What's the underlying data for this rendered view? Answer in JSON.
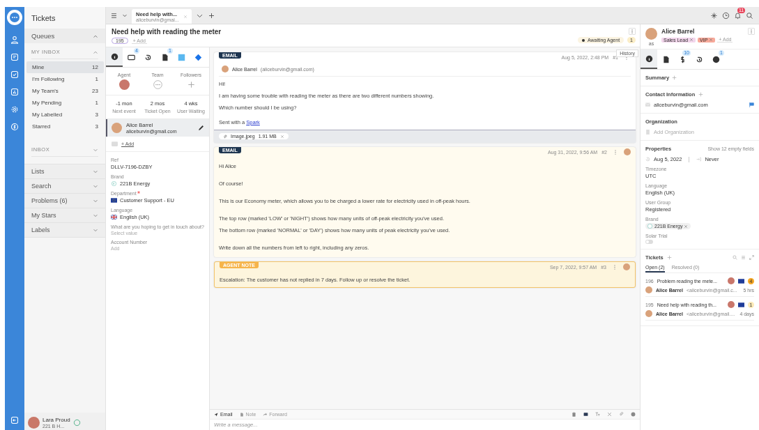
{
  "sidebar": {
    "title": "Tickets",
    "queues": {
      "label": "Queues",
      "expanded": true
    },
    "my_inbox": {
      "label": "MY INBOX",
      "expanded": true,
      "items": [
        {
          "label": "Mine",
          "count": "12",
          "selected": true
        },
        {
          "label": "I'm Following",
          "count": "1",
          "selected": false
        },
        {
          "label": "My Team's",
          "count": "23",
          "selected": false
        },
        {
          "label": "My Pending",
          "count": "1",
          "selected": false
        },
        {
          "label": "My Labelled",
          "count": "3",
          "selected": false
        },
        {
          "label": "Starred",
          "count": "3",
          "selected": false
        }
      ]
    },
    "inbox": {
      "label": "INBOX",
      "expanded": false
    },
    "sections": [
      {
        "label": "Lists",
        "expanded": false
      },
      {
        "label": "Search",
        "expanded": false
      },
      {
        "label": "Problems (6)",
        "expanded": false
      },
      {
        "label": "My Stars",
        "expanded": false
      },
      {
        "label": "Labels",
        "expanded": false
      }
    ],
    "user": {
      "name": "Lara Proud",
      "brand": "221 B H..."
    }
  },
  "tabbar": {
    "tabs": [
      {
        "title": "Need help with...",
        "subtitle": "aliceburvin@gmai...",
        "selected": true
      }
    ],
    "notifications": "11"
  },
  "ticket": {
    "title": "Need help with reading the meter",
    "id": "195",
    "add_label": "+ Add",
    "status": "Awaiting Agent",
    "status_count": "1",
    "tooltip": "History"
  },
  "details": {
    "tabs": [
      {
        "selected": true
      },
      {
        "badge": "4",
        "selected": false
      },
      {
        "selected": false
      },
      {
        "badge": "1",
        "selected": false
      },
      {
        "selected": false
      },
      {
        "selected": false
      }
    ],
    "people": [
      {
        "label": "Agent",
        "kind": "avatar"
      },
      {
        "label": "Team",
        "kind": "chat"
      },
      {
        "label": "Followers",
        "kind": "add"
      }
    ],
    "stats": [
      {
        "value": "-1 mon",
        "label": "Next event"
      },
      {
        "value": "2 mos",
        "label": "Ticket Open"
      },
      {
        "value": "4 wks",
        "label": "User Waiting"
      }
    ],
    "requester": {
      "name": "Alice Barrel",
      "email": "aliceburvin@gmail.com"
    },
    "cc_add": "+ Add",
    "fields": [
      {
        "label": "Ref",
        "value": "DLLV-7196-DZBY",
        "kind": "text",
        "required": false
      },
      {
        "label": "Brand",
        "value": "221B Energy",
        "kind": "brand",
        "required": false
      },
      {
        "label": "Department",
        "value": "Customer Support - EU",
        "kind": "eu",
        "required": true
      },
      {
        "label": "Language",
        "value": "English (UK)",
        "kind": "uk",
        "required": false
      },
      {
        "label": "What are you hoping to get in touch about?",
        "placeholder": "Select value",
        "kind": "empty",
        "required": false
      },
      {
        "label": "Account Number",
        "placeholder": "Add",
        "kind": "empty",
        "required": false
      }
    ]
  },
  "messages": [
    {
      "kind": "incoming",
      "badge": "EMAIL",
      "date": "Aug 5, 2022, 2:48 PM",
      "number": "#1",
      "sender": "Alice Barrel",
      "sender_email": "(aliceburvin@gmail.com)",
      "blocks": [
        {
          "lines": [
            {
              "text": "Hi!"
            },
            {
              "text": "I am having some trouble with reading the meter as there are two different numbers showing."
            },
            {
              "text": "Which number should I be using?"
            }
          ]
        },
        {
          "lines": [
            {
              "text": "Sent with a ",
              "link": "Spark"
            }
          ]
        }
      ],
      "attachment": {
        "name": "Image.jpeg",
        "size": "1.91 MB"
      }
    },
    {
      "kind": "outgoing",
      "badge": "EMAIL",
      "date": "Aug 31, 2022, 9:56 AM",
      "number": "#2",
      "blocks": [
        {
          "lines": [
            {
              "text": "Hi Alice"
            }
          ]
        },
        {
          "lines": [
            {
              "text": "Of course!"
            }
          ]
        },
        {
          "lines": [
            {
              "text": "This is our Economy meter, which allows you to be charged a lower rate for electricity used in off-peak hours."
            }
          ]
        },
        {
          "lines": [
            {
              "text": "The top row (marked 'LOW' or 'NIGHT') shows how many units of off-peak electricity you've used."
            },
            {
              "text": "The bottom row (marked 'NORMAL' or 'DAY') shows how many units of peak electricity you've used."
            }
          ]
        },
        {
          "lines": [
            {
              "text": "Write down all the numbers from left to right, including any zeros."
            }
          ]
        }
      ]
    },
    {
      "kind": "note",
      "badge": "AGENT NOTE",
      "date": "Sep 7, 2022, 9:57 AM",
      "number": "#3",
      "blocks": [
        {
          "lines": [
            {
              "text": "Escalation: The customer has not replied in 7 days. Follow up or resolve the ticket."
            }
          ]
        }
      ]
    }
  ],
  "composer": {
    "tabs": [
      {
        "label": "Email",
        "selected": true
      },
      {
        "label": "Note",
        "selected": false
      },
      {
        "label": "Forward",
        "selected": false
      }
    ],
    "placeholder": "Write a message..."
  },
  "contact": {
    "name": "Alice Barrel",
    "initials": "as",
    "tags": [
      {
        "label": "Sales Lead",
        "color": "#f3d6ec"
      },
      {
        "label": "VIP",
        "color": "#f7a99a"
      }
    ],
    "add_label": "+ Add",
    "tabs": [
      {
        "selected": true
      },
      {
        "selected": false
      },
      {
        "badge": "10",
        "selected": false
      },
      {
        "selected": false
      },
      {
        "badge": "1",
        "selected": false
      }
    ],
    "summary": "Summary",
    "contact_info": "Contact Information",
    "email": "aliceburvin@gmail.com",
    "organization": "Organization",
    "org_placeholder": "Add Organization",
    "properties": "Properties",
    "empty_fields": "Show 12 empty fields",
    "created": "Aug 5, 2022",
    "last_login": "Never",
    "fields": [
      {
        "label": "Timezone",
        "value": "UTC"
      },
      {
        "label": "Language",
        "value": "English (UK)"
      },
      {
        "label": "User Group",
        "value": "Registered"
      }
    ],
    "brand_label": "Brand",
    "brand": "221B Energy",
    "solar_label": "Solar Trial",
    "solar_on": false,
    "tickets_title": "Tickets",
    "ticket_tabs": [
      {
        "label": "Open (2)",
        "selected": true
      },
      {
        "label": "Resolved (0)",
        "selected": false
      }
    ],
    "tickets": [
      {
        "id": "196",
        "title": "Problem reading the mete...",
        "count": "4",
        "color": "#f5a623",
        "name": "Alice Barrel",
        "email": "<aliceburvin@gmail.c...",
        "time": "5 hrs"
      },
      {
        "id": "195",
        "title": "Need help with reading th...",
        "count": "1",
        "color": "#fbe9b7",
        "name": "Alice Barrel",
        "email": "<aliceburvin@gmail....",
        "time": "4 days"
      }
    ]
  }
}
